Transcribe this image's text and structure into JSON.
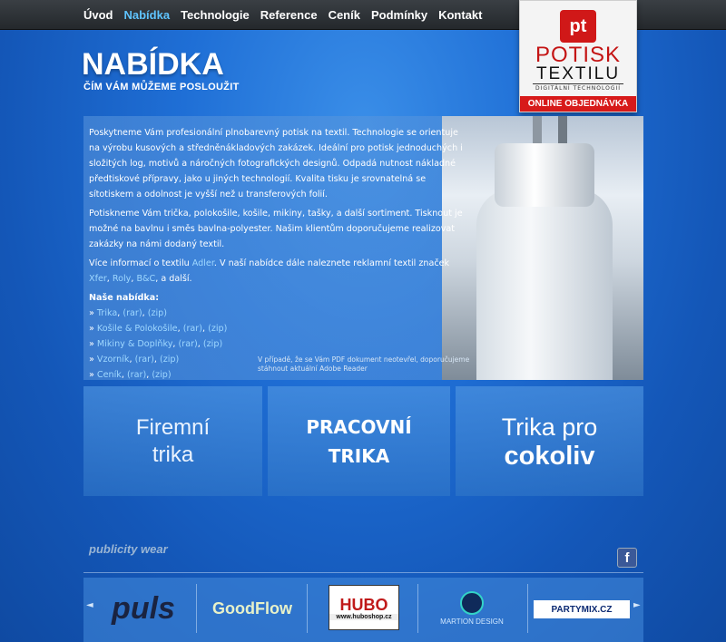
{
  "nav": {
    "items": [
      "Úvod",
      "Nabídka",
      "Technologie",
      "Reference",
      "Ceník",
      "Podmínky",
      "Kontakt"
    ],
    "active_index": 1
  },
  "logo": {
    "mark": "pt",
    "line1": "POTISK",
    "line2": "TEXTILU",
    "line3": "DIGITÁLNÍ TECHNOLOGIÍ",
    "order_button": "ONLINE OBJEDNÁVKA"
  },
  "page": {
    "title": "NABÍDKA",
    "subtitle": "ČÍM VÁM MŮŽEME POSLOUŽIT"
  },
  "content": {
    "para1": "Poskytneme Vám profesionální plnobarevný potisk na textil. Technologie se orientuje na výrobu kusových a středněnákladových zakázek. Ideální pro potisk jednoduchých i složitých log, motivů a náročných fotografických designů. Odpadá nutnost nákladné předtiskové přípravy, jako u jiných technologií. Kvalita tisku je srovnatelná se sítotiskem a odolnost je vyšší než u transferových folií.",
    "para2": "Potiskneme Vám trička, polokošile, košile, mikiny, tašky, a další sortiment. Tisknout je možné na bavlnu i směs bavlna-polyester. Našim klientům doporučujeme realizovat zakázky na námi dodaný textil.",
    "para3_start": "Více informací o textilu ",
    "para3_link1": "Adler",
    "para3_mid": ". V naší nabídce dále naleznete reklamní textil značek ",
    "para3_link2": "Xfer",
    "para3_comma1": ", ",
    "para3_link3": "Roly",
    "para3_comma2": ", ",
    "para3_link4": "B&C",
    "para3_end": ", a další.",
    "offer_heading": "Naše nabídka:",
    "offers": [
      {
        "name": "Trika",
        "rar": "(rar)",
        "zip": "(zip)"
      },
      {
        "name": "Košile & Polokošile",
        "rar": "(rar)",
        "zip": "(zip)"
      },
      {
        "name": "Mikiny & Doplňky",
        "rar": "(rar)",
        "zip": "(zip)"
      },
      {
        "name": "Vzorník",
        "rar": "(rar)",
        "zip": "(zip)"
      },
      {
        "name": "Ceník",
        "rar": "(rar)",
        "zip": "(zip)"
      }
    ],
    "bullet": "» ",
    "note": "V případě, že se Vám PDF dokument neotevřel, doporučujeme stáhnout aktuální Adobe Reader"
  },
  "cards": {
    "card1_line1": "Firemní",
    "card1_line2": "trika",
    "card2_line1": "PRACOVNÍ",
    "card2_line2": "TRIKA",
    "card3_line1": "Trika pro",
    "card3_line2": "cokoliv"
  },
  "footer": {
    "publicity": "publicity wear",
    "facebook_glyph": "f",
    "arrow_left": "◄",
    "arrow_right": "►",
    "partners": {
      "p1": "puls",
      "p2": "GoodFlow",
      "p3_big": "HUBO",
      "p3_small": "www.huboshop.cz",
      "p4": "MARTION DESIGN",
      "p5": "PARTYMIX.CZ"
    }
  }
}
